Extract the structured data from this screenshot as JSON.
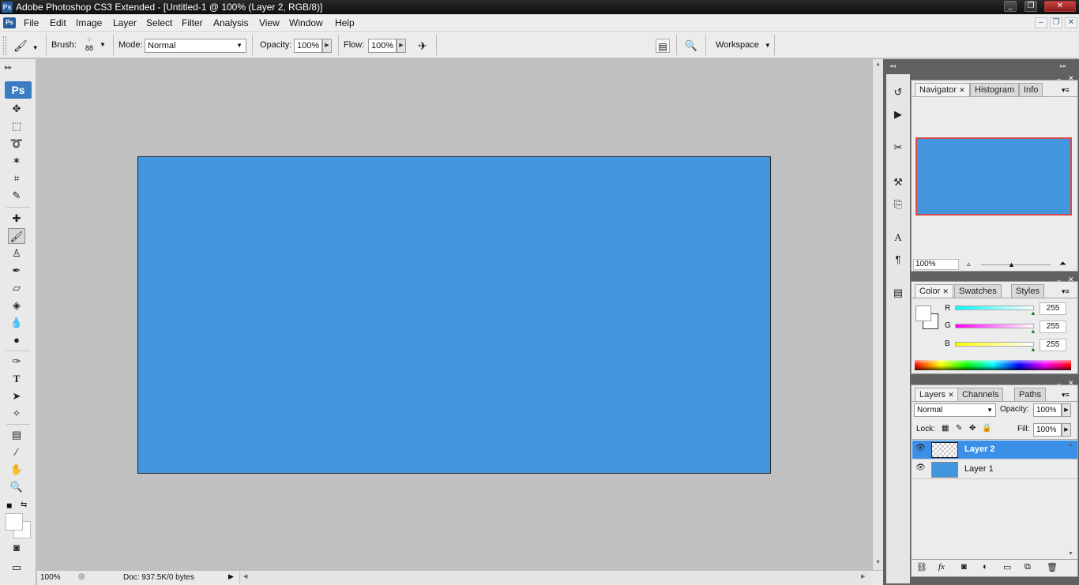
{
  "window": {
    "title": "Adobe Photoshop CS3 Extended - [Untitled-1 @ 100% (Layer 2, RGB/8)]",
    "badge": "Ps",
    "minimize": "_",
    "restore": "❐",
    "close": "✕"
  },
  "menubar": {
    "items": [
      "File",
      "Edit",
      "Image",
      "Layer",
      "Select",
      "Filter",
      "Analysis",
      "View",
      "Window",
      "Help"
    ],
    "mdi": [
      "–",
      "❐",
      "✕"
    ]
  },
  "options": {
    "brush_label": "Brush:",
    "brush_size": "88",
    "mode_label": "Mode:",
    "mode_value": "Normal",
    "opacity_label": "Opacity:",
    "opacity_value": "100%",
    "flow_label": "Flow:",
    "flow_value": "100%",
    "workspace_label": "Workspace"
  },
  "toolbox": {
    "logo": "Ps"
  },
  "canvas": {
    "fill_color": "#4296de"
  },
  "status": {
    "zoom": "100%",
    "doc_info": "Doc: 937.5K/0 bytes"
  },
  "navigator": {
    "tabs": [
      "Navigator",
      "Histogram",
      "Info"
    ],
    "zoom": "100%",
    "frame_color": "#d94b4b"
  },
  "color_panel": {
    "tabs": [
      "Color",
      "Swatches",
      "Styles"
    ],
    "channels": [
      {
        "label": "R",
        "value": "255"
      },
      {
        "label": "G",
        "value": "255"
      },
      {
        "label": "B",
        "value": "255"
      }
    ]
  },
  "layers_panel": {
    "tabs": [
      "Layers",
      "Channels",
      "Paths"
    ],
    "blend_mode": "Normal",
    "opacity_label": "Opacity:",
    "opacity_value": "100%",
    "lock_label": "Lock:",
    "fill_label": "Fill:",
    "fill_value": "100%",
    "layers": [
      {
        "name": "Layer 2",
        "selected": true
      },
      {
        "name": "Layer 1",
        "selected": false
      }
    ]
  }
}
